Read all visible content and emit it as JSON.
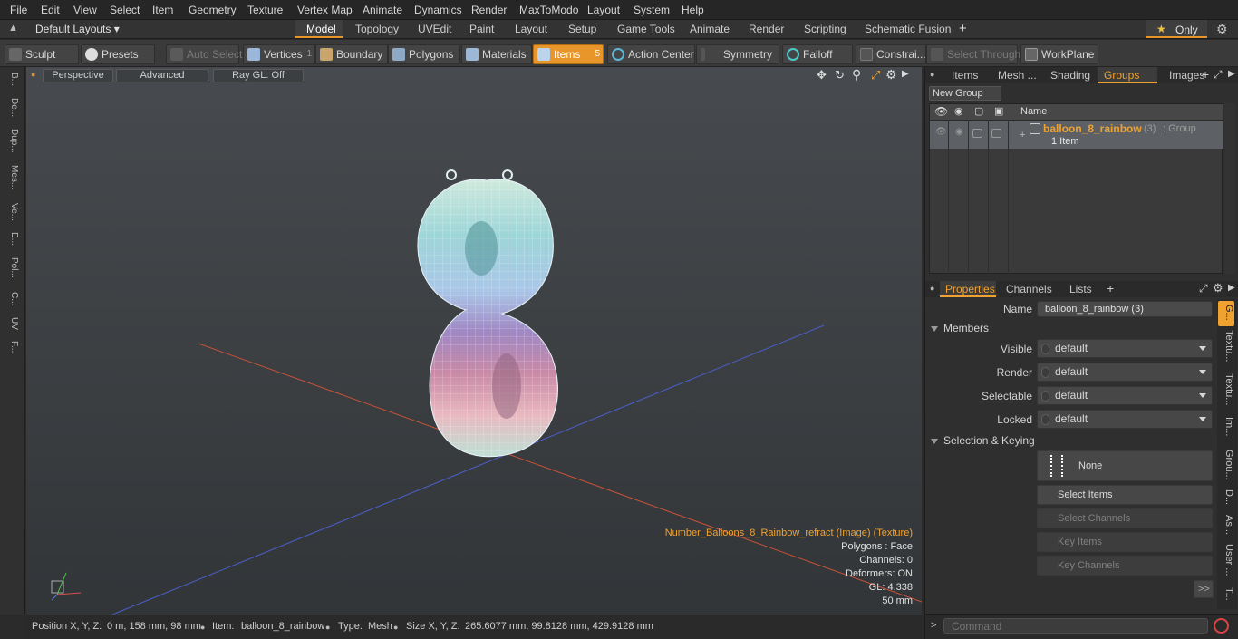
{
  "menu": [
    "File",
    "Edit",
    "View",
    "Select",
    "Item",
    "Geometry",
    "Texture",
    "Vertex Map",
    "Animate",
    "Dynamics",
    "Render",
    "MaxToModo",
    "Layout",
    "System",
    "Help"
  ],
  "layouts": {
    "label": "Default Layouts"
  },
  "layout_tabs": [
    "Model",
    "Topology",
    "UVEdit",
    "Paint",
    "Layout",
    "Setup",
    "Game Tools",
    "Animate",
    "Render",
    "Scripting",
    "Schematic Fusion"
  ],
  "only_label": "Only",
  "toolbar": {
    "sculpt": "Sculpt",
    "presets": "Presets",
    "auto_select": "Auto Select",
    "vertices": "Vertices",
    "vertices_count": "1",
    "boundary": "Boundary",
    "polygons": "Polygons",
    "materials": "Materials",
    "items": "Items",
    "items_count": "5",
    "action_center": "Action Center",
    "symmetry": "Symmetry",
    "falloff": "Falloff",
    "constraints": "Constrai...",
    "select_through": "Select Through",
    "workplane": "WorkPlane"
  },
  "left_tabs": [
    "B...",
    "De...",
    "Dup...",
    "Mes...",
    "Ve...",
    "E...",
    "Pol...",
    "C...",
    "UV",
    "F..."
  ],
  "viewport": {
    "perspective": "Perspective",
    "advanced": "Advanced",
    "raygl": "Ray GL: Off",
    "info": {
      "texture": "Number_Balloons_8_Rainbow_refract (Image) (Texture)",
      "polygons": "Polygons : Face",
      "channels": "Channels: 0",
      "deformers": "Deformers: ON",
      "gl": "GL: 4,338",
      "scale": "50 mm"
    }
  },
  "status": {
    "position_label": "Position X, Y, Z:",
    "position_value": "0 m, 158 mm, 98 mm",
    "item_label": "Item:",
    "item_value": "balloon_8_rainbow",
    "type_label": "Type:",
    "type_value": "Mesh",
    "size_label": "Size X, Y, Z:",
    "size_value": "265.6077 mm, 99.8128 mm, 429.9128 mm"
  },
  "groups_panel": {
    "tabs": [
      "Items",
      "Mesh ...",
      "Shading",
      "Groups",
      "Images"
    ],
    "active_tab": "Groups",
    "new_group": "New Group",
    "name_header": "Name",
    "row": {
      "name": "balloon_8_rainbow",
      "count": "(3)",
      "kind": ": Group",
      "sub": "1 Item"
    }
  },
  "properties_panel": {
    "tabs": [
      "Properties",
      "Channels",
      "Lists"
    ],
    "name_label": "Name",
    "name_value": "balloon_8_rainbow (3)",
    "members": "Members",
    "rows": [
      {
        "label": "Visible",
        "value": "default"
      },
      {
        "label": "Render",
        "value": "default"
      },
      {
        "label": "Selectable",
        "value": "default"
      },
      {
        "label": "Locked",
        "value": "default"
      }
    ],
    "selection_keying": "Selection & Keying",
    "none": "None",
    "select_items": "Select Items",
    "select_channels": "Select Channels",
    "key_items": "Key Items",
    "key_channels": "Key Channels",
    "more": ">>",
    "side_tabs": [
      "G...",
      "Textu...",
      "Textu...",
      "Im...",
      "Grou...",
      "D...",
      "As...",
      "User ...",
      "T..."
    ]
  },
  "command": {
    "placeholder": "Command"
  },
  "colors": {
    "accent": "#f0a230",
    "items_active": "#e8952a",
    "selected_row": "#5d6166"
  }
}
